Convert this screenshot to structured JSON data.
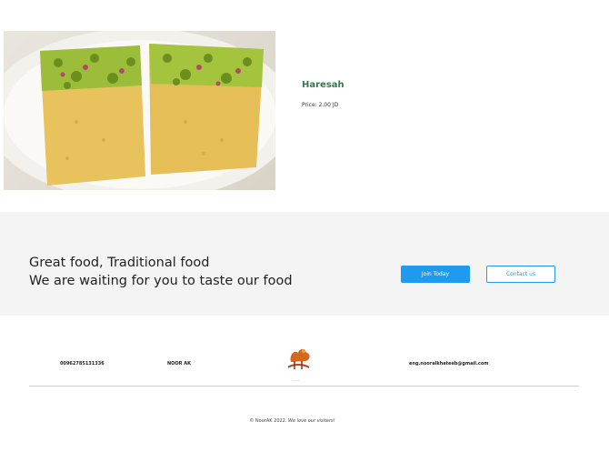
{
  "product": {
    "name": "Haresah",
    "price": "Price: 2.00 JD"
  },
  "cta": {
    "line1": "Great food, Traditional food",
    "line2": "We are waiting for you to taste our food",
    "join_label": "Join Today",
    "contact_label": "Contact us"
  },
  "footer": {
    "phone": "00962785131336",
    "brand_name": "NOOR AK",
    "logo_icon": "dessert-logo-icon",
    "logo_caption": "~~~",
    "email": "eng.nooralkhateeb@gmail.com",
    "copyright_prefix": "© NoorAK 2022.",
    "copyright_italic": "We love our visiters!"
  },
  "colors": {
    "accent": "#1e9bf0",
    "product_name": "#2e7d4f",
    "band": "#f4f4f4"
  }
}
